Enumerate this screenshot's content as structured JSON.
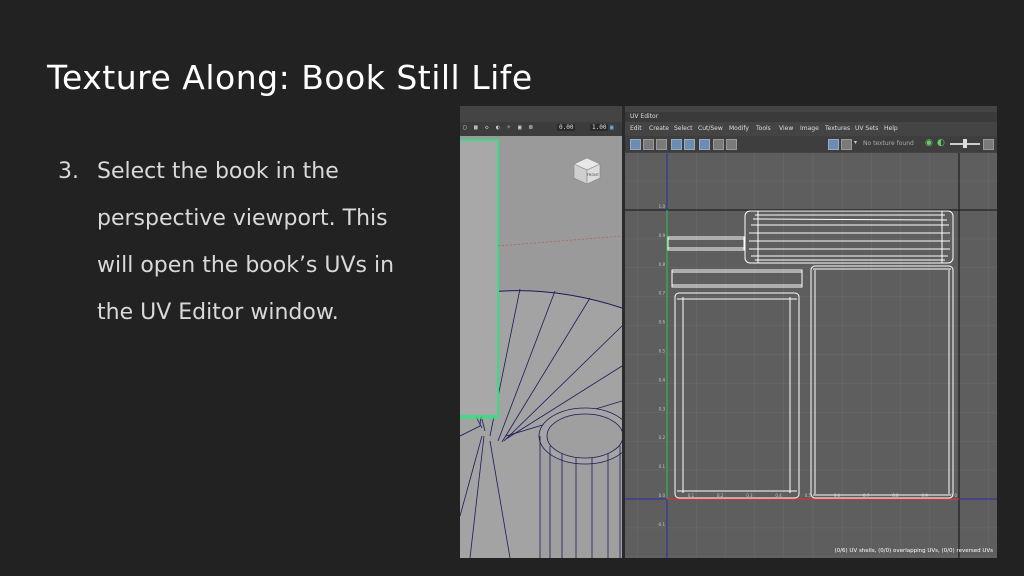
{
  "slide": {
    "title": "Texture Along: Book Still Life",
    "step_number": "3.",
    "step_lines": [
      "Select the book in the",
      "perspective viewport. This",
      "will open the book’s UVs in",
      "the UV Editor window."
    ]
  },
  "viewport": {
    "toolbar_values": [
      "0.00",
      "1.00"
    ],
    "view_cube_label": "FRONT"
  },
  "uv_editor": {
    "title": "UV Editor",
    "menu": [
      "Edit",
      "Create",
      "Select",
      "Cut/Sew",
      "Modify",
      "Tools",
      "View",
      "Image",
      "Textures",
      "UV Sets",
      "Help"
    ],
    "no_texture": "No texture found",
    "grid_labels": {
      "v": [
        "1.0",
        "0.9",
        "0.8",
        "0.7",
        "0.6",
        "0.5",
        "0.4",
        "0.3",
        "0.2",
        "0.1",
        "0.0",
        "-0.1"
      ],
      "u": [
        "0.1",
        "0.2",
        "0.3",
        "0.4",
        "0.5",
        "0.6",
        "0.7",
        "0.8",
        "0.9",
        "1.0"
      ]
    },
    "status": "(0/6) UV shells, (0/0) overlapping UVs, (0/0) reversed UVs"
  },
  "colors": {
    "background": "#222222",
    "selection_green": "#3ddc84",
    "uv_wire": "#ffffff",
    "v_axis": "#2fb84a",
    "u_axis": "#e03030",
    "mesh_wire": "#1a1a5a"
  }
}
